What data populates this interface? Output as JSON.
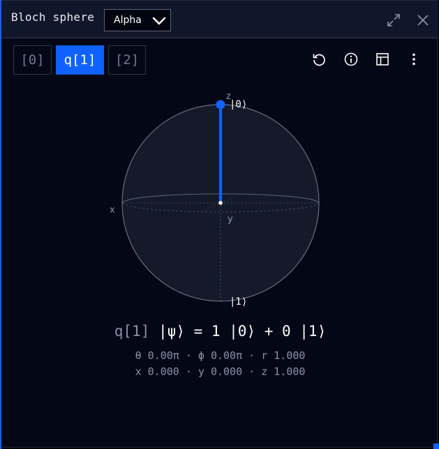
{
  "header": {
    "title": "Bloch sphere",
    "dropdown_value": "Alpha",
    "icons": [
      "expand-icon",
      "close-icon"
    ]
  },
  "tabs": [
    {
      "label": "[0]",
      "active": false
    },
    {
      "label": "q[1]",
      "active": true
    },
    {
      "label": "[2]",
      "active": false
    }
  ],
  "toolbar": {
    "icons": [
      "reset-icon",
      "info-icon",
      "table-icon",
      "overflow-menu-icon"
    ]
  },
  "sphere": {
    "axis_labels": {
      "z": "z",
      "x": "x",
      "y": "y"
    },
    "ket_zero": "|0⟩",
    "ket_one": "|1⟩",
    "vector": {
      "theta_pi": 0.0,
      "phi_pi": 0.0,
      "r": 1.0
    }
  },
  "state": {
    "qubit": "q[1]",
    "expression": "|ψ⟩ = 1 |0⟩ + 0 |1⟩"
  },
  "coords": {
    "angles": "θ 0.00π · ϕ 0.00π · r 1.000",
    "cartesian": "x 0.000 · y 0.000 · z 1.000"
  },
  "colors": {
    "accent": "#0f62fe",
    "background": "#030716",
    "header": "#11172a",
    "muted_text": "#8a92a6"
  }
}
